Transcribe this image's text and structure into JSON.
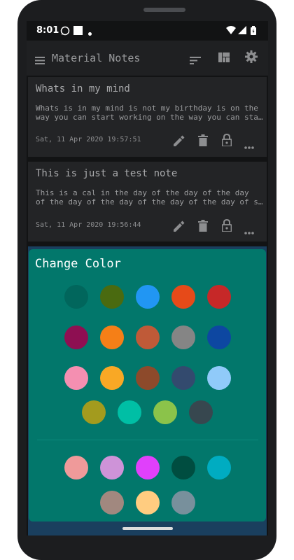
{
  "status": {
    "time": "8:01"
  },
  "app": {
    "title": "Material Notes"
  },
  "notes": [
    {
      "title": "Whats in my mind",
      "body_line1": "Whats is in my mind is not my birthday is on the",
      "body_line2": "way you can start working on the way you can start working",
      "date": "Sat, 11 Apr 2020 19:57:51"
    },
    {
      "title": "This is just a test note",
      "body_line1": "This is a cal in the day of the day of the day",
      "body_line2": "of the day of the day of the day of the day of school",
      "date": "Sat, 11 Apr 2020 19:56:44"
    }
  ],
  "icons": {
    "menu": "menu-icon",
    "sort": "sort-icon",
    "view": "dashboard-icon",
    "settings": "gear-icon",
    "edit": "pencil-icon",
    "delete": "trash-icon",
    "lock": "lock-icon",
    "more": "more-horiz-icon"
  },
  "dialog": {
    "title": "Change Color",
    "background": "#02776b",
    "colors_primary": [
      "#01665c",
      "#4a6a10",
      "#2196f3",
      "#e64a19",
      "#c62828",
      "#8e0f52",
      "#f57f17",
      "#bf5a38",
      "#858585",
      "#0d47a1",
      "#f48fb1",
      "#f9a825",
      "#8d4a2b",
      "#334a6e",
      "#90caf9",
      "#a39b1e",
      "#00bfa5",
      "#8bc34a",
      "#37474f"
    ],
    "colors_secondary": [
      "#ef9a9a",
      "#ce93d8",
      "#e040fb",
      "#004d40",
      "#00acc1",
      "#a1887f",
      "#ffcc80",
      "#78909c"
    ]
  }
}
